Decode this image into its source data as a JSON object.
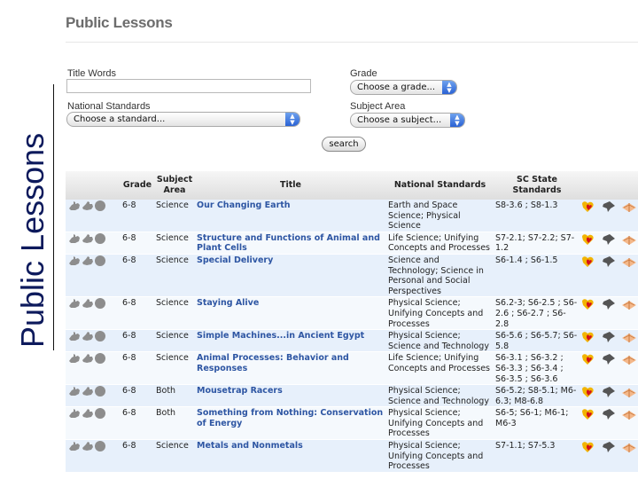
{
  "page": {
    "title": "Public Lessons",
    "side_title": "Public Lessons"
  },
  "form": {
    "title_words_label": "Title Words",
    "title_words_value": "",
    "national_standards_label": "National Standards",
    "national_standards_value": "Choose a standard...",
    "grade_label": "Grade",
    "grade_value": "Choose a grade...",
    "subject_area_label": "Subject Area",
    "subject_area_value": "Choose a subject...",
    "search_label": "search"
  },
  "table": {
    "headers": {
      "grade": "Grade",
      "subject": "Subject Area",
      "title": "Title",
      "national": "National Standards",
      "sc": "SC State Standards"
    },
    "rows": [
      {
        "grade": "6-8",
        "subject": "Science",
        "title": "Our Changing Earth",
        "national": "Earth and Space Science; Physical Science",
        "sc": "S8-3.6 ; S8-1.3"
      },
      {
        "grade": "6-8",
        "subject": "Science",
        "title": "Structure and Functions of Animal and Plant Cells",
        "national": "Life Science; Unifying Concepts and Processes",
        "sc": "S7-2.1; S7-2.2; S7-1.2"
      },
      {
        "grade": "6-8",
        "subject": "Science",
        "title": "Special Delivery",
        "national": "Science and Technology; Science in Personal and Social Perspectives",
        "sc": "S6-1.4 ; S6-1.5"
      },
      {
        "grade": "6-8",
        "subject": "Science",
        "title": "Staying Alive",
        "national": "Physical Science; Unifying Concepts and Processes",
        "sc": "S6.2-3; S6-2.5 ; S6-2.6 ; S6-2.7 ; S6-2.8"
      },
      {
        "grade": "6-8",
        "subject": "Science",
        "title": "Simple Machines...in Ancient Egypt",
        "national": "Physical Science; Science and Technology",
        "sc": "S6-5.6 ; S6-5.7; S6-5.8"
      },
      {
        "grade": "6-8",
        "subject": "Science",
        "title": "Animal Processes: Behavior and Responses",
        "national": "Life Science; Unifying Concepts and Processes",
        "sc": "S6-3.1 ; S6-3.2 ; S6-3.3 ; S6-3.4 ; S6-3.5 ; S6-3.6"
      },
      {
        "grade": "6-8",
        "subject": "Both",
        "title": "Mousetrap Racers",
        "national": "Physical Science; Science and Technology",
        "sc": "S6-5.2; S8-5.1; M6-6.3; M8-6.8"
      },
      {
        "grade": "6-8",
        "subject": "Both",
        "title": "Something from Nothing: Conservation of Energy",
        "national": "Physical Science; Unifying Concepts and Processes",
        "sc": "S6-5; S6-1; M6-1; M6-3"
      },
      {
        "grade": "6-8",
        "subject": "Science",
        "title": "Metals and Nonmetals",
        "national": "Physical Science; Unifying Concepts and Processes",
        "sc": "S7-1.1; S7-5.3"
      }
    ]
  },
  "colors": {
    "side_title": "#0d1a5c",
    "link": "#2e56a3",
    "row_odd": "#e7f0fb",
    "row_even": "#f5f9fd",
    "select_arrow": "#2a62d4"
  },
  "icons": {
    "row_leading": [
      "hand-icon",
      "hand-icon",
      "circle-icon"
    ],
    "row_actions": [
      "heart-icon",
      "pushpin-icon",
      "open-book-icon"
    ]
  }
}
